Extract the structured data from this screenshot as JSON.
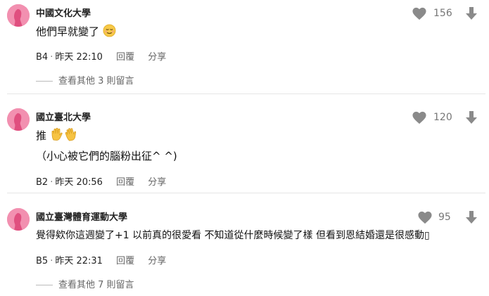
{
  "comments": [
    {
      "author": "中國文化大學",
      "lines": [
        "他們早就變了"
      ],
      "emoji": [
        "relieved-face"
      ],
      "floor": "B4",
      "time": "昨天 22:10",
      "reply_label": "回覆",
      "share_label": "分享",
      "likes": "156",
      "more_replies": "查看其他 3 則留言"
    },
    {
      "author": "國立臺北大學",
      "lines": [
        "推",
        "（小心被它們的腦粉出征^ ^)"
      ],
      "emoji": [
        "raised-hand",
        "waving-hand"
      ],
      "floor": "B2",
      "time": "昨天 20:56",
      "reply_label": "回覆",
      "share_label": "分享",
      "likes": "120"
    },
    {
      "author": "國立臺灣體育運動大學",
      "lines": [
        "覺得欸你這週變了+1 以前真的很愛看 不知道從什麼時候變了樣 但看到恩結婚還是很感動"
      ],
      "trailing_glyph": "▯",
      "floor": "B5",
      "time": "昨天 22:31",
      "reply_label": "回覆",
      "share_label": "分享",
      "likes": "95",
      "more_replies": "查看其他 7 則留言"
    }
  ],
  "colors": {
    "avatar": "#f290b0",
    "icon_gray": "#8a8a8a",
    "divider": "#e6e6e6"
  }
}
